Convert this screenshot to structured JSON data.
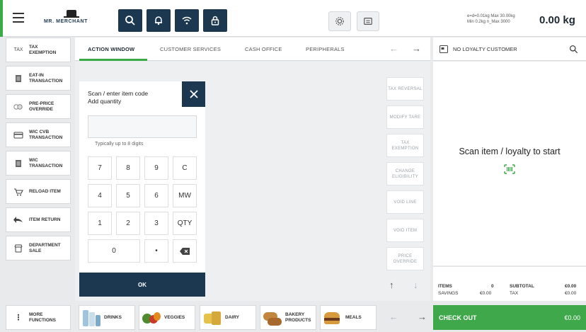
{
  "header": {
    "brand": "MR. MERCHANT",
    "scale_info_line1": "e=d=0.01kg Max 30.00kg",
    "scale_info_line2": "Min 0.2kg n_Max 3000",
    "weight": "0.00 kg"
  },
  "sidebar": {
    "items": [
      {
        "icon_text": "TAX",
        "label": "TAX EXEMPTION"
      },
      {
        "label": "EAT-IN TRANSACTION"
      },
      {
        "label": "PRE-PRICE OVERRIDE"
      },
      {
        "label": "WIC CVB TRANSACTION"
      },
      {
        "label": "WIC TRANSACTION"
      },
      {
        "label": "RELOAD ITEM"
      },
      {
        "label": "ITEM RETURN"
      },
      {
        "label": "DEPARTMENT SALE"
      }
    ],
    "more_label": "MORE FUNCTIONS"
  },
  "tabs": [
    "ACTION WINDOW",
    "CUSTOMER SERVICES",
    "CASH OFFICE",
    "PERIPHERALS"
  ],
  "keypad": {
    "title_line1": "Scan / enter item code",
    "title_line2": "Add quantity",
    "input_value": "",
    "hint": "Typically up to 8 digits",
    "keys": [
      "7",
      "8",
      "9",
      "C",
      "4",
      "5",
      "6",
      "MW",
      "1",
      "2",
      "3",
      "QTY",
      "0",
      "•"
    ],
    "ok_label": "OK"
  },
  "actions": [
    "TAX REVERSAL",
    "MODIFY TARE",
    "TAX EXEMPTION",
    "CHANGE ELIGIBILITY",
    "VOID LINE",
    "VOID ITEM",
    "PRICE OVERRIDE"
  ],
  "loyalty": {
    "status": "NO LOYALTY CUSTOMER",
    "scan_message": "Scan item / loyalty to start"
  },
  "summary": {
    "items_label": "ITEMS",
    "items_value": "0",
    "subtotal_label": "SUBTOTAL",
    "subtotal_value": "€0.00",
    "savings_label": "SAVINGS",
    "savings_value": "€0.00",
    "tax_label": "TAX",
    "tax_value": "€0.00"
  },
  "categories": [
    {
      "label": "DRINKS"
    },
    {
      "label": "VEGGIES"
    },
    {
      "label": "DAIRY"
    },
    {
      "label": "BAKERY PRODUCTS"
    },
    {
      "label": "MEALS"
    }
  ],
  "checkout": {
    "label": "CHECK OUT",
    "amount": "€0.00"
  },
  "colors": {
    "accent": "#3aa946",
    "navy": "#1c3850",
    "checkout": "#3ea84a"
  }
}
